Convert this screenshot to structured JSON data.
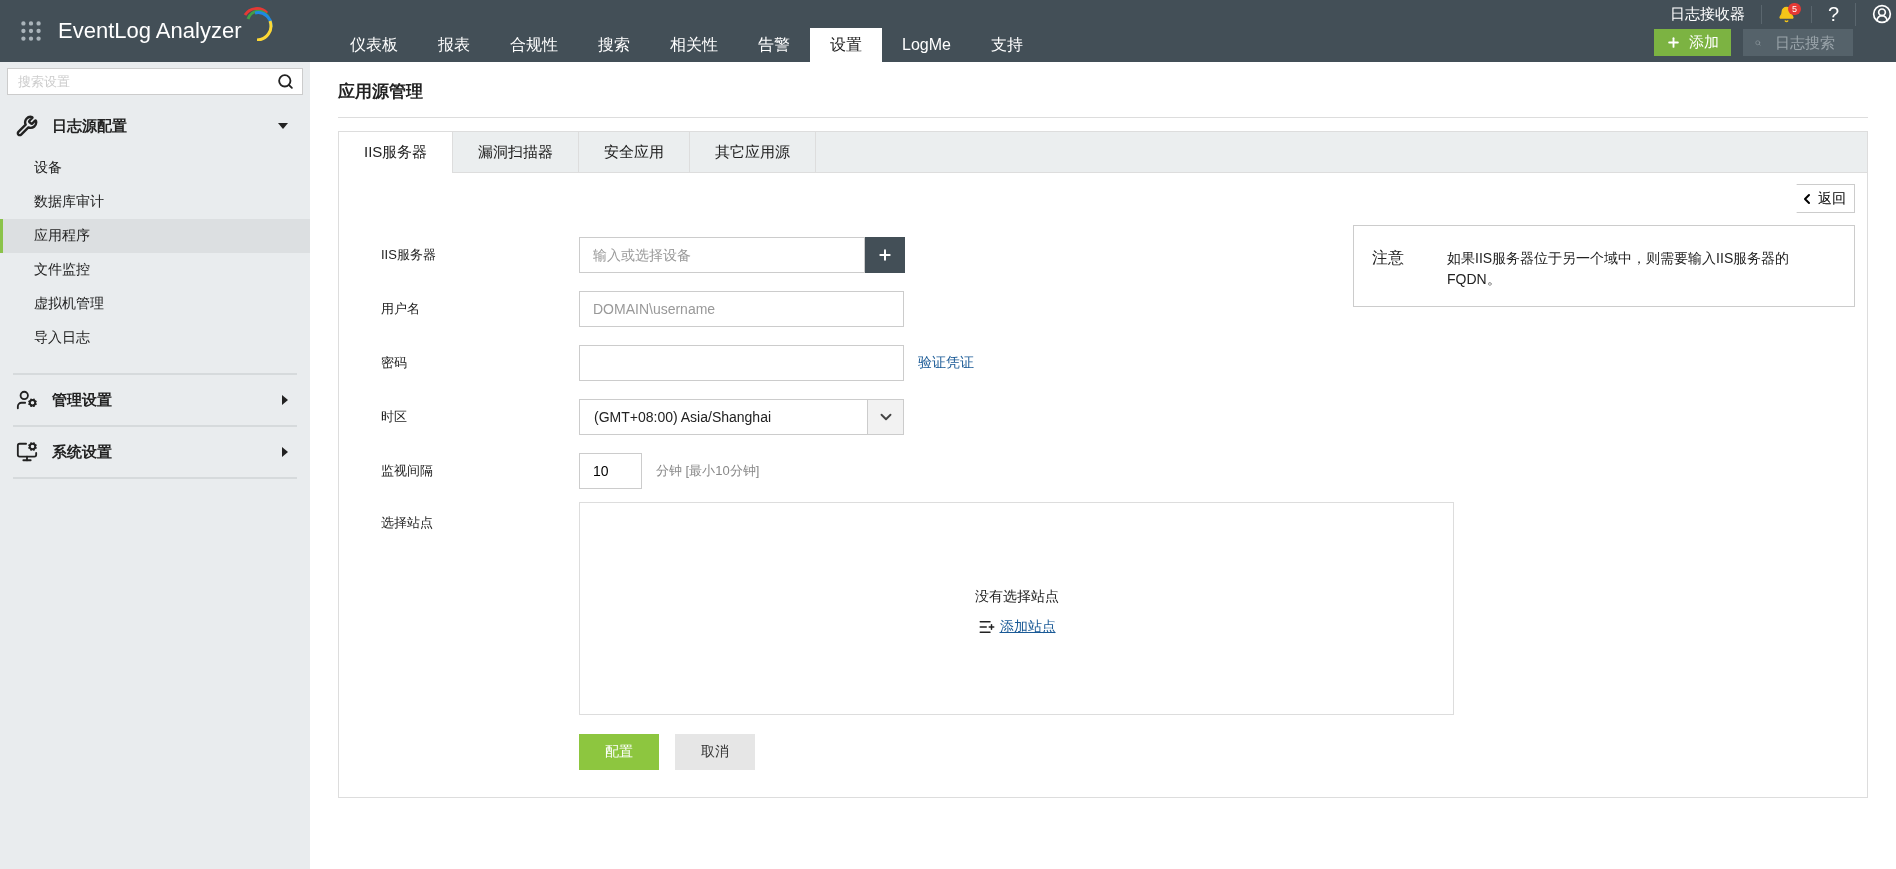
{
  "app": {
    "logo": "EventLog Analyzer"
  },
  "nav": [
    {
      "label": "仪表板",
      "selected": false
    },
    {
      "label": "报表",
      "selected": false
    },
    {
      "label": "合规性",
      "selected": false
    },
    {
      "label": "搜索",
      "selected": false
    },
    {
      "label": "相关性",
      "selected": false
    },
    {
      "label": "告警",
      "selected": false
    },
    {
      "label": "设置",
      "selected": true
    },
    {
      "label": "LogMe",
      "selected": false
    },
    {
      "label": "支持",
      "selected": false
    }
  ],
  "top_right": {
    "receiver": "日志接收器",
    "notifications": "5",
    "help": "?",
    "add_button": "添加",
    "search_placeholder": "日志搜索"
  },
  "sidebar": {
    "search_placeholder": "搜索设置",
    "sections": [
      {
        "kind": "tools",
        "label": "日志源配置",
        "expanded": true,
        "items": [
          {
            "label": "设备",
            "selected": false
          },
          {
            "label": "数据库审计",
            "selected": false
          },
          {
            "label": "应用程序",
            "selected": true
          },
          {
            "label": "文件监控",
            "selected": false
          },
          {
            "label": "虚拟机管理",
            "selected": false
          },
          {
            "label": "导入日志",
            "selected": false
          }
        ]
      },
      {
        "kind": "admin",
        "label": "管理设置",
        "expanded": false
      },
      {
        "kind": "system",
        "label": "系统设置",
        "expanded": false
      }
    ]
  },
  "page": {
    "title": "应用源管理",
    "tabs": [
      {
        "label": "IIS服务器",
        "selected": true
      },
      {
        "label": "漏洞扫描器",
        "selected": false
      },
      {
        "label": "安全应用",
        "selected": false
      },
      {
        "label": "其它应用源",
        "selected": false
      }
    ],
    "back": "返回",
    "note": {
      "title": "注意",
      "text": "如果IIS服务器位于另一个域中，则需要输入IIS服务器的FQDN。"
    },
    "form": [
      {
        "kind": "device",
        "label": "IIS服务器",
        "placeholder": "输入或选择设备"
      },
      {
        "kind": "text",
        "label": "用户名",
        "placeholder": "DOMAIN\\username"
      },
      {
        "kind": "password",
        "label": "密码",
        "link": "验证凭证"
      },
      {
        "kind": "select",
        "label": "时区",
        "value": "(GMT+08:00) Asia/Shanghai"
      },
      {
        "kind": "number",
        "label": "监视间隔",
        "value": "10",
        "hint": "分钟 [最小10分钟]"
      },
      {
        "kind": "sites",
        "label": "选择站点",
        "empty": "没有选择站点",
        "link": "添加站点"
      }
    ],
    "buttons": [
      {
        "kind": "primary",
        "label": "配置"
      },
      {
        "kind": "secondary",
        "label": "取消"
      }
    ]
  }
}
